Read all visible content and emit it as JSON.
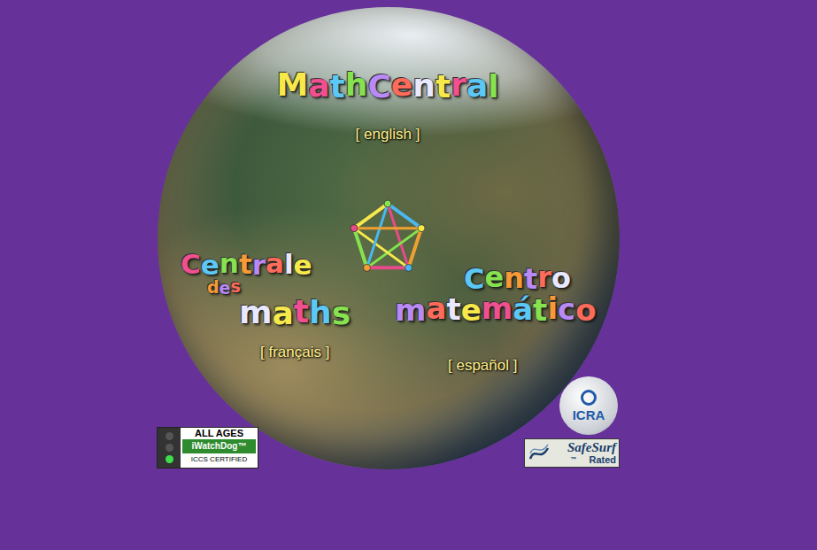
{
  "globe": {
    "sites": [
      {
        "logo": [
          "Math Central"
        ],
        "link": "[ english ]"
      },
      {
        "logo": [
          "Centrale",
          "des",
          "maths"
        ],
        "link": "[ français ]"
      },
      {
        "logo": [
          "Centro",
          "matemático"
        ],
        "link": "[ español ]"
      }
    ]
  },
  "badges": {
    "iwatchdog": {
      "top": "ALL AGES",
      "name": "iWatchDog™",
      "bottom": "ICCS CERTIFIED"
    },
    "icra": "ICRA",
    "safesurf": {
      "name": "SafeSurf",
      "mark": "™",
      "sub": "Rated"
    }
  }
}
